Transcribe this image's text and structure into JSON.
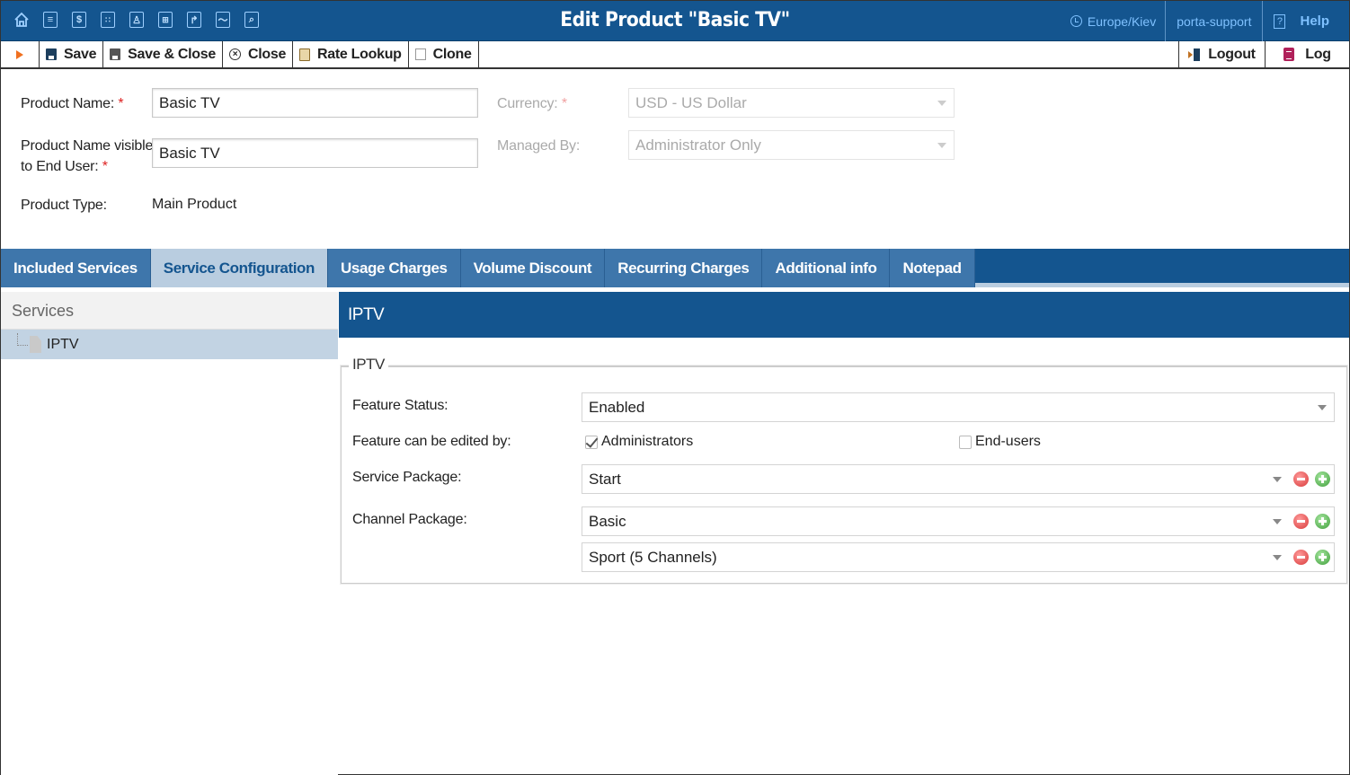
{
  "header": {
    "title": "Edit Product \"Basic TV\"",
    "nav_icons": [
      "home-icon",
      "list-icon",
      "dollar-icon",
      "modules-icon",
      "user-icon",
      "network-icon",
      "routing-icon",
      "statistics-icon",
      "search-icon"
    ],
    "timezone": "Europe/Kiev",
    "user": "porta-support",
    "help_label": "Help"
  },
  "toolbar": {
    "save": "Save",
    "save_close": "Save & Close",
    "close": "Close",
    "rate_lookup": "Rate Lookup",
    "clone": "Clone",
    "logout": "Logout",
    "log": "Log"
  },
  "form": {
    "product_name_label": "Product Name:",
    "product_name_value": "Basic TV",
    "visible_name_label_1": "Product Name visible",
    "visible_name_label_2": "to End User:",
    "visible_name_value": "Basic TV",
    "product_type_label": "Product Type:",
    "product_type_value": "Main Product",
    "currency_label": "Currency:",
    "currency_value": "USD - US Dollar",
    "managed_by_label": "Managed By:",
    "managed_by_value": "Administrator Only",
    "required_mark": "*"
  },
  "tabs": [
    {
      "label": "Included Services",
      "active": false
    },
    {
      "label": "Service Configuration",
      "active": true
    },
    {
      "label": "Usage Charges",
      "active": false
    },
    {
      "label": "Volume Discount",
      "active": false
    },
    {
      "label": "Recurring Charges",
      "active": false
    },
    {
      "label": "Additional info",
      "active": false
    },
    {
      "label": "Notepad",
      "active": false
    }
  ],
  "services_panel": {
    "title": "Services",
    "items": [
      {
        "label": "IPTV",
        "selected": true
      }
    ]
  },
  "config": {
    "header": "IPTV",
    "legend": "IPTV",
    "feature_status_label": "Feature Status:",
    "feature_status_value": "Enabled",
    "edited_by_label": "Feature can be edited by:",
    "administrators_label": "Administrators",
    "administrators_checked": true,
    "end_users_label": "End-users",
    "end_users_checked": false,
    "service_package_label": "Service Package:",
    "service_package_value": "Start",
    "channel_package_label": "Channel Package:",
    "channel_packages": [
      "Basic",
      "Sport (5 Channels)"
    ]
  }
}
